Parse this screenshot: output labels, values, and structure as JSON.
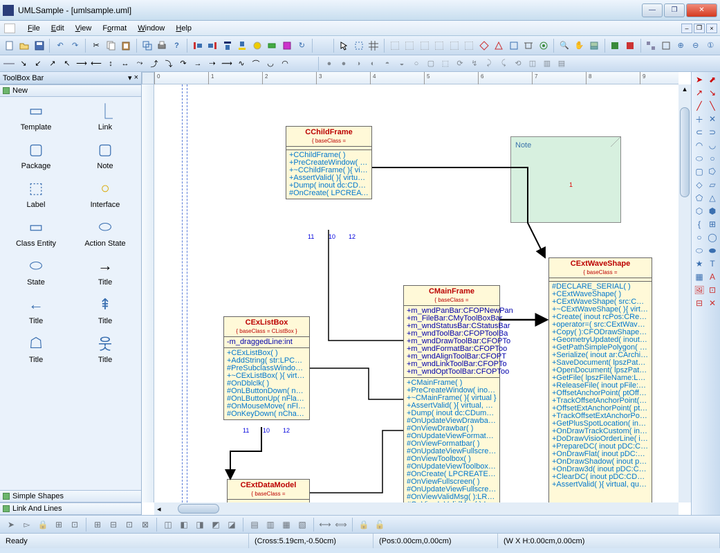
{
  "window": {
    "title": "UMLSample - [umlsample.uml]"
  },
  "menu": {
    "file": "File",
    "edit": "Edit",
    "view": "View",
    "format": "Format",
    "window": "Window",
    "help": "Help"
  },
  "toolbox": {
    "title": "ToolBox Bar",
    "new": "New",
    "simple": "Simple Shapes",
    "link": "Link And Lines",
    "items": [
      {
        "label": "Template"
      },
      {
        "label": "Link"
      },
      {
        "label": "Package"
      },
      {
        "label": "Note"
      },
      {
        "label": "Label"
      },
      {
        "label": "Interface"
      },
      {
        "label": "Class Entity"
      },
      {
        "label": "Action State"
      },
      {
        "label": "State"
      },
      {
        "label": "Title"
      },
      {
        "label": "Title"
      },
      {
        "label": "Title"
      },
      {
        "label": "Title"
      },
      {
        "label": "Title"
      }
    ]
  },
  "note": {
    "text": "Note"
  },
  "uml": {
    "childframe": {
      "name": "CChildFrame",
      "base": "{ baseClass =",
      "ops": [
        "+CChildFrame( )",
        "+PreCreateWindow( inout cs:C",
        "+~CChildFrame( ){ virtual }",
        "+AssertValid( ){ virtual, query",
        "+Dump( inout dc:CDumpConte",
        "#OnCreate( LPCREATESTRU"
      ]
    },
    "exlistbox": {
      "name": "CExListBox",
      "base": "{ baseClass = CListBox }",
      "attrs": [
        "-m_draggedLine:int"
      ],
      "ops": [
        "+CExListBox( )",
        "+AddString( str:LPCTSTR ):in",
        "#PreSubclassWindow( ){ virtu",
        "+~CExListBox( ){ virtual }",
        "#OnDblclk( )",
        "#OnLButtonDown( nFlags:UI",
        "#OnLButtonUp( nFlags:UINT,",
        "#OnMouseMove( nFlags:UIN",
        "#OnKeyDown( nChar:UINT, n"
      ]
    },
    "mainframe": {
      "name": "CMainFrame",
      "base": "{ baseClass =",
      "attrs": [
        "+m_wndPanBar:CFOPNewPan",
        "+m_FileBar:CMyToolBoxBar",
        "+m_wndStatusBar:CStatusBar",
        "+m_wndToolBar:CFOPToolBa",
        "+m_wndDrawToolBar:CFOPTo",
        "+m_wndFormatBar:CFOPToo",
        "+m_wndAlignToolBar:CFOPT",
        "+m_wndLinkToolBar:CFOPTo",
        "+m_wndOptToolBar:CFOPToo"
      ],
      "ops": [
        "+CMainFrame( )",
        "+PreCreateWindow( inout cs:C",
        "+~CMainFrame( ){ virtual }",
        "+AssertValid( ){ virtual, query",
        "+Dump( inout dc:CDumpConte",
        "#OnUpdateViewDrawbar( inou",
        "#OnViewDrawbar( )",
        "#OnUpdateViewFormatbar( in",
        "#OnViewFormatbar( )",
        "#OnUpdateViewFullscreen( ino",
        "#OnViewToolbox( )",
        "#OnUpdateViewToolbox( inout",
        "#OnCreate( LPCREATESTRU",
        "#OnViewFullscreen( )",
        "#OnUpdateViewFullscreen( ino",
        "#OnViewValidMsg( ):LRESUl",
        "#OnViewInValidMsg( ):LRES"
      ]
    },
    "waveshape": {
      "name": "CExtWaveShape",
      "base": "{ baseClass =",
      "ops": [
        "#DECLARE_SERIAL( )",
        "+CExtWaveShape( )",
        "+CExtWaveShape( src:CExtWa",
        "+~CExtWaveShape( ){ virtual }",
        "+Create( inout rcPos:CRect, str",
        "+operator=( src:CExtWaveShap",
        "+Copy( ):CFODrawShape*{ vi",
        "+GeometryUpdated( inout pRg",
        "+GetPathSimplePolygon( inout",
        "+Serialize( inout ar:CArchive )",
        "+SaveDocument( lpszPathNam",
        "+OpenDocument( lpszPathNam",
        "+GetFile( lpszFileName:LPCTS",
        "+ReleaseFile( inout pFile:CFile",
        "+OffsetAnchorPoint( ptOffset:C",
        "+TrackOffsetAnchorPoint( ptO",
        "+OffsetExtAnchorPoint( ptOffs",
        "+TrackOffsetExtAnchorPoint( p",
        "+GetPlusSpotLocation( inout l",
        "+OnDrawTrackCustom( inout p",
        "+DoDrawVisioOrderLine( inou",
        "+PrepareDC( inout pDC:CDC )",
        "+OnDrawFlat( inout pDC:CDC",
        "+OnDrawShadow( inout pDC:",
        "+OnDraw3d( inout pDC:CDC )",
        "+ClearDC( inout pDC:CDC ){ v",
        "+AssertValid( ){ virtual, query"
      ]
    },
    "datamodel": {
      "name": "CExtDataModel",
      "base": "{ baseClass ="
    }
  },
  "status": {
    "ready": "Ready",
    "cross": "(Cross:5.19cm,-0.50cm)",
    "pos": "(Pos:0.00cm,0.00cm)",
    "wh": "(W X H:0.00cm,0.00cm)"
  },
  "ruler": {
    "marks": [
      "0",
      "1",
      "2",
      "3",
      "4",
      "5",
      "6",
      "7",
      "8",
      "9"
    ]
  }
}
